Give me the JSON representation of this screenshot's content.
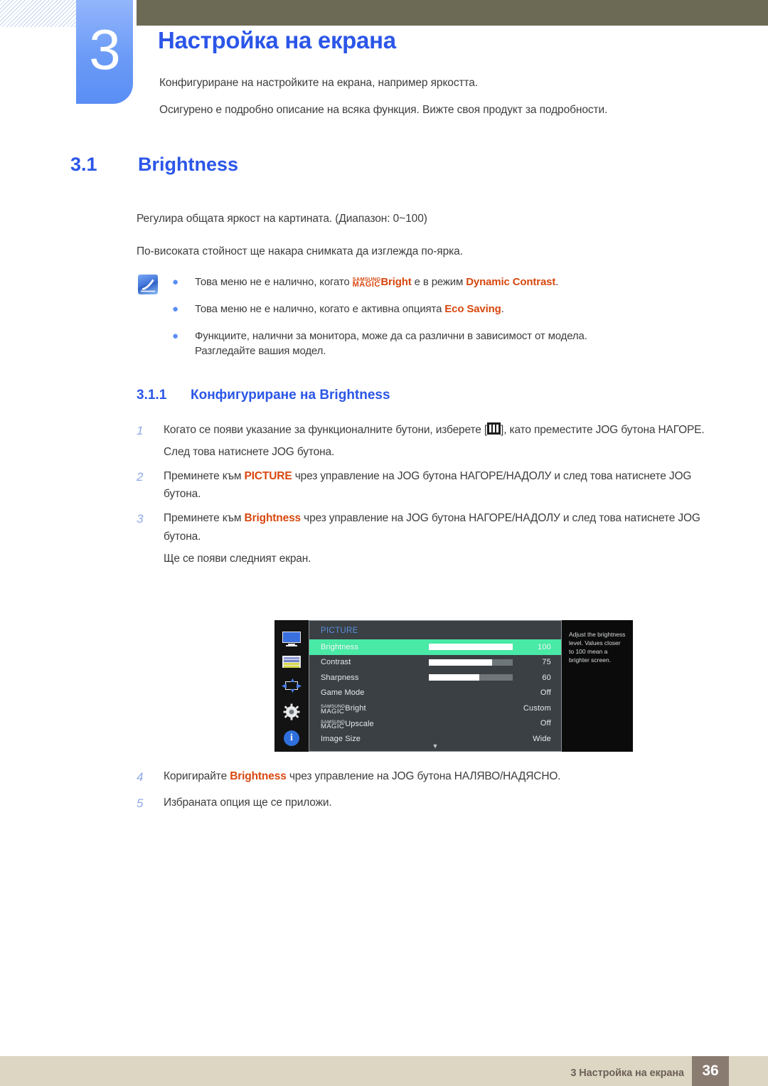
{
  "header": {
    "chapter_number": "3",
    "chapter_title": "Настройка на екрана",
    "sub1": "Конфигуриране на настройките на екрана, например яркостта.",
    "sub2": "Осигурено е подробно описание на всяка функция. Вижте своя продукт за подробности."
  },
  "section": {
    "number": "3.1",
    "name": "Brightness",
    "para1": "Регулира общата яркост на картината. (Диапазон: 0~100)",
    "para2": "По-високата стойност ще накара снимката да изглежда по-ярка."
  },
  "notes": {
    "bullet": "●",
    "items": [
      {
        "pre": "Това меню не е налично, когато ",
        "magic_s": "SAMSUNG",
        "magic_m": "MAGIC",
        "magic_suffix": "Bright",
        "mid": " е в режим ",
        "hl": "Dynamic Contrast",
        "post": ".",
        "cont": ""
      },
      {
        "pre": "Това меню не е налично, когато е активна опцията ",
        "magic_s": "",
        "magic_m": "",
        "magic_suffix": "",
        "mid": "",
        "hl": "Eco Saving",
        "post": ".",
        "cont": ""
      },
      {
        "pre": "Функциите, налични за монитора, може да са различни в зависимост от модела.",
        "magic_s": "",
        "magic_m": "",
        "magic_suffix": "",
        "mid": "",
        "hl": "",
        "post": "",
        "cont": "Разгледайте вашия модел."
      }
    ]
  },
  "subsection": {
    "number": "3.1.1",
    "title": "Конфигуриране на Brightness"
  },
  "steps": [
    {
      "num": "1",
      "pre": "Когато се появи указание за функционалните бутони, изберете [",
      "icon": "jog-menu-icon",
      "post": "], като преместите JOG бутона НАГОРЕ.",
      "hl": "",
      "extra": "След това натиснете JOG бутона."
    },
    {
      "num": "2",
      "pre": "Преминете към ",
      "hl": "PICTURE",
      "post": " чрез управление на JOG бутона НАГОРЕ/НАДОЛУ и след това натиснете JOG бутона.",
      "extra": ""
    },
    {
      "num": "3",
      "pre": "Преминете към ",
      "hl": "Brightness",
      "post": " чрез управление на JOG бутона НАГОРЕ/НАДОЛУ и след това натиснете JOG бутона.",
      "extra": "Ще се появи следният екран."
    },
    {
      "num": "4",
      "pre": "Коригирайте ",
      "hl": "Brightness",
      "post": " чрез управление на JOG бутона НАЛЯВО/НАДЯСНО.",
      "extra": ""
    },
    {
      "num": "5",
      "pre": "Избраната опция ще се приложи.",
      "hl": "",
      "post": "",
      "extra": ""
    }
  ],
  "osd": {
    "title": "PICTURE",
    "sidebar_icons": [
      "monitor-icon",
      "osd-list-icon",
      "screen-size-icon",
      "gear-icon",
      "info-icon"
    ],
    "down_arrow": "▼",
    "rows": [
      {
        "label": "Brightness",
        "value": "100",
        "bar": 100,
        "selected": true,
        "magic": false
      },
      {
        "label": "Contrast",
        "value": "75",
        "bar": 75,
        "selected": false,
        "magic": false
      },
      {
        "label": "Sharpness",
        "value": "60",
        "bar": 60,
        "selected": false,
        "magic": false
      },
      {
        "label": "Game Mode",
        "value": "Off",
        "bar": -1,
        "selected": false,
        "magic": false
      },
      {
        "label": "Bright",
        "value": "Custom",
        "bar": -1,
        "selected": false,
        "magic": true,
        "magic_s": "SAMSUNG",
        "magic_m": "MAGIC"
      },
      {
        "label": "Upscale",
        "value": "Off",
        "bar": -1,
        "selected": false,
        "magic": true,
        "magic_s": "SAMSUNG",
        "magic_m": "MAGIC"
      },
      {
        "label": "Image Size",
        "value": "Wide",
        "bar": -1,
        "selected": false,
        "magic": false
      }
    ],
    "help_text": "Adjust the brightness level. Values closer to 100 mean a brighter screen."
  },
  "footer": {
    "text": "3 Настройка на екрана",
    "page": "36"
  },
  "colors": {
    "heading_blue": "#2b56e8",
    "badge_blue": "#6b9bf7",
    "olive": "#6c6a55",
    "highlight_orange": "#d8480f",
    "osd_select_green": "#49e9a6",
    "footer_beige": "#dcd6c3",
    "footer_brown": "#8a7b71"
  }
}
